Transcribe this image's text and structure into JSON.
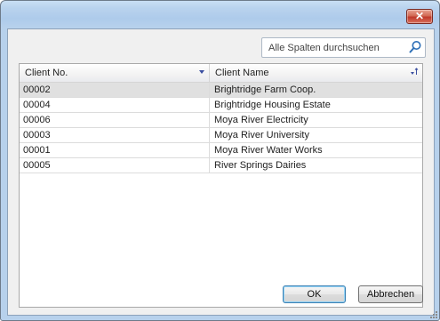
{
  "window": {
    "close_glyph": "✕"
  },
  "search": {
    "placeholder": "Alle Spalten durchsuchen",
    "value": ""
  },
  "grid": {
    "columns": [
      "Client No.",
      "Client Name"
    ],
    "rows": [
      {
        "no": "00002",
        "name": "Brightridge Farm Coop.",
        "selected": true
      },
      {
        "no": "00004",
        "name": "Brightridge Housing Estate"
      },
      {
        "no": "00006",
        "name": "Moya River Electricity"
      },
      {
        "no": "00003",
        "name": "Moya River University"
      },
      {
        "no": "00001",
        "name": "Moya River Water Works"
      },
      {
        "no": "00005",
        "name": "River Springs Dairies"
      }
    ]
  },
  "buttons": {
    "ok": "OK",
    "cancel": "Abbrechen"
  },
  "colors": {
    "accent": "#3a4ea0",
    "selection": "#e0e0e0",
    "close": "#c0392b"
  }
}
